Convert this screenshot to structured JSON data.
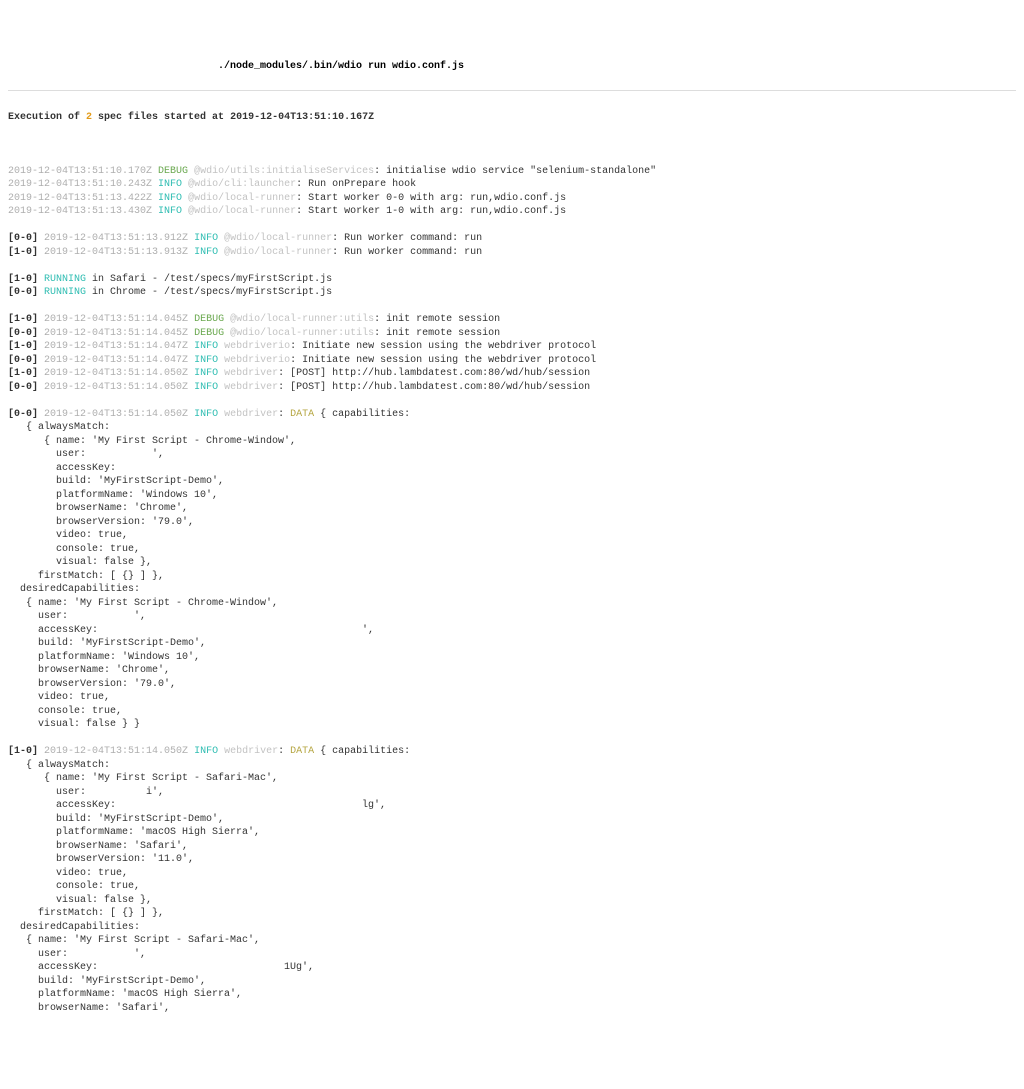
{
  "header": {
    "prefix": "./node_modules/.bin/wdio run wdio.conf.js"
  },
  "exec": {
    "pre": "Execution of ",
    "count": "2",
    "mid": " spec files started at ",
    "time": "2019-12-04T13:51:10.167Z"
  },
  "levels": {
    "debug": "DEBUG",
    "info": "INFO",
    "data": "DATA"
  },
  "l": [
    {
      "ts": "2019-12-04T13:51:10.170Z",
      "lvl": "DEBUG",
      "src": "@wdio/utils:initialiseServices",
      "msg": ": initialise wdio service \"selenium-standalone\""
    },
    {
      "ts": "2019-12-04T13:51:10.243Z",
      "lvl": "INFO",
      "src": "@wdio/cli:launcher",
      "msg": ": Run onPrepare hook"
    },
    {
      "ts": "2019-12-04T13:51:13.422Z",
      "lvl": "INFO",
      "src": "@wdio/local-runner",
      "msg": ": Start worker 0-0 with arg: run,wdio.conf.js"
    },
    {
      "ts": "2019-12-04T13:51:13.430Z",
      "lvl": "INFO",
      "src": "@wdio/local-runner",
      "msg": ": Start worker 1-0 with arg: run,wdio.conf.js"
    }
  ],
  "l2": [
    {
      "wk": "[0-0]",
      "ts": "2019-12-04T13:51:13.912Z",
      "lvl": "INFO",
      "src": "@wdio/local-runner",
      "msg": ": Run worker command: run"
    },
    {
      "wk": "[1-0]",
      "ts": "2019-12-04T13:51:13.913Z",
      "lvl": "INFO",
      "src": "@wdio/local-runner",
      "msg": ": Run worker command: run"
    }
  ],
  "run": [
    {
      "wk": "[1-0]",
      "status": "RUNNING",
      "msg": " in Safari - /test/specs/myFirstScript.js"
    },
    {
      "wk": "[0-0]",
      "status": "RUNNING",
      "msg": " in Chrome - /test/specs/myFirstScript.js"
    }
  ],
  "l3": [
    {
      "wk": "[1-0]",
      "ts": "2019-12-04T13:51:14.045Z",
      "lvl": "DEBUG",
      "src": "@wdio/local-runner:utils",
      "msg": ": init remote session"
    },
    {
      "wk": "[0-0]",
      "ts": "2019-12-04T13:51:14.045Z",
      "lvl": "DEBUG",
      "src": "@wdio/local-runner:utils",
      "msg": ": init remote session"
    },
    {
      "wk": "[1-0]",
      "ts": "2019-12-04T13:51:14.047Z",
      "lvl": "INFO",
      "src": "webdriverio",
      "msg": ": Initiate new session using the webdriver protocol"
    },
    {
      "wk": "[0-0]",
      "ts": "2019-12-04T13:51:14.047Z",
      "lvl": "INFO",
      "src": "webdriverio",
      "msg": ": Initiate new session using the webdriver protocol"
    },
    {
      "wk": "[1-0]",
      "ts": "2019-12-04T13:51:14.050Z",
      "lvl": "INFO",
      "src": "webdriver",
      "msg": ": [POST] http://hub.lambdatest.com:80/wd/hub/session"
    },
    {
      "wk": "[0-0]",
      "ts": "2019-12-04T13:51:14.050Z",
      "lvl": "INFO",
      "src": "webdriver",
      "msg": ": [POST] http://hub.lambdatest.com:80/wd/hub/session"
    }
  ],
  "caps1": {
    "wk": "[0-0]",
    "ts": "2019-12-04T13:51:14.050Z",
    "lvl": "INFO",
    "src": "webdriver",
    "msgHead": " { capabilities:",
    "lines": [
      "   { alwaysMatch:",
      "      { name: 'My First Script - Chrome-Window',",
      "        user:           ',",
      "        accessKey:",
      "        build: 'MyFirstScript-Demo',",
      "        platformName: 'Windows 10',",
      "        browserName: 'Chrome',",
      "        browserVersion: '79.0',",
      "        video: true,",
      "        console: true,",
      "        visual: false },",
      "     firstMatch: [ {} ] },",
      "  desiredCapabilities:",
      "   { name: 'My First Script - Chrome-Window',",
      "     user:           ',",
      "     accessKey:                                            ',",
      "     build: 'MyFirstScript-Demo',",
      "     platformName: 'Windows 10',",
      "     browserName: 'Chrome',",
      "     browserVersion: '79.0',",
      "     video: true,",
      "     console: true,",
      "     visual: false } }"
    ]
  },
  "caps2": {
    "wk": "[1-0]",
    "ts": "2019-12-04T13:51:14.050Z",
    "lvl": "INFO",
    "src": "webdriver",
    "msgHead": " { capabilities:",
    "lines": [
      "   { alwaysMatch:",
      "      { name: 'My First Script - Safari-Mac',",
      "        user:          i',",
      "        accessKey:                                         lg',",
      "        build: 'MyFirstScript-Demo',",
      "        platformName: 'macOS High Sierra',",
      "        browserName: 'Safari',",
      "        browserVersion: '11.0',",
      "        video: true,",
      "        console: true,",
      "        visual: false },",
      "     firstMatch: [ {} ] },",
      "  desiredCapabilities:",
      "   { name: 'My First Script - Safari-Mac',",
      "     user:           ',",
      "     accessKey:                               1Ug',",
      "     build: 'MyFirstScript-Demo',",
      "     platformName: 'macOS High Sierra',",
      "     browserName: 'Safari',"
    ]
  }
}
